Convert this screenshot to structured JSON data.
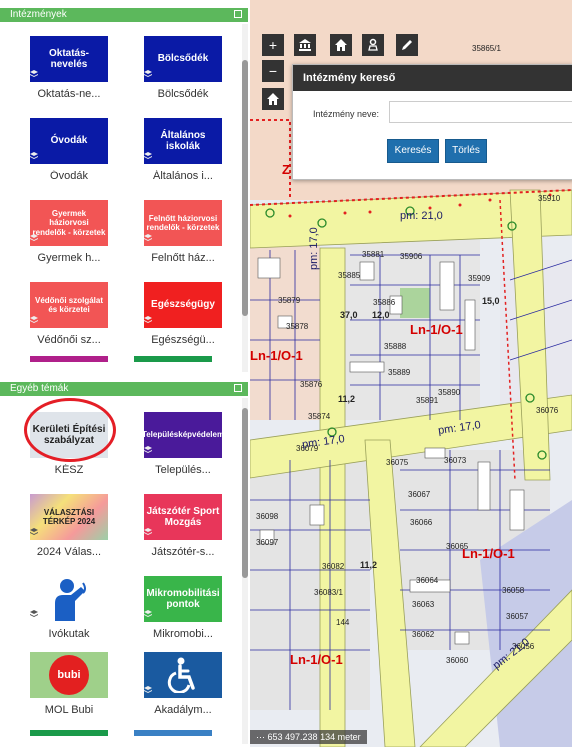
{
  "sidebar": {
    "institutions": {
      "title": "Intézmények",
      "tiles": [
        {
          "thumb": "Oktatás-nevelés",
          "label": "Oktatás-ne...",
          "color": "#0a1aa6"
        },
        {
          "thumb": "Bölcsődék",
          "label": "Bölcsődék",
          "color": "#0a1aa6"
        },
        {
          "thumb": "Óvodák",
          "label": "Óvodák",
          "color": "#0a1aa6"
        },
        {
          "thumb": "Általános iskolák",
          "label": "Általános i...",
          "color": "#0a1aa6"
        },
        {
          "thumb": "Gyermek háziorvosi rendelők - körzetek",
          "label": "Gyermek h...",
          "color": "#f25555"
        },
        {
          "thumb": "Felnőtt háziorvosi rendelők - körzetek",
          "label": "Felnőtt ház...",
          "color": "#f25555"
        },
        {
          "thumb": "Védőnői szolgálat és körzetei",
          "label": "Védőnői sz...",
          "color": "#f25555"
        },
        {
          "thumb": "Egészségügy",
          "label": "Egészségü...",
          "color": "#f02020"
        }
      ]
    },
    "other": {
      "title": "Egyéb témák",
      "tiles": [
        {
          "thumb": "Kerületi Építési szabályzat",
          "label": "KÉSZ",
          "color": "#e8e8e8"
        },
        {
          "thumb": "Településképvédelem",
          "label": "Település...",
          "color": "#4a1a9a"
        },
        {
          "thumb": "VÁLASZTÁSI TÉRKÉP 2024",
          "label": "2024 Válas...",
          "color": "#c89bd0"
        },
        {
          "thumb": "Játszótér Sport Mozgás",
          "label": "Játszótér-s...",
          "color": "#e8365a"
        },
        {
          "thumb": "",
          "label": "Ivókutak",
          "color": "#1b5fc4"
        },
        {
          "thumb": "Mikromobilitási pontok",
          "label": "Mikromobi...",
          "color": "#39b54a"
        },
        {
          "thumb": "bubi",
          "label": "MOL Bubi",
          "color": "#e32020"
        },
        {
          "thumb": "",
          "label": "Akadálym...",
          "color": "#1a5aa0"
        }
      ]
    }
  },
  "toolbar": {
    "zoom_in": "+",
    "zoom_out": "−"
  },
  "search_dialog": {
    "title": "Intézmény kereső",
    "field_label": "Intézmény neve:",
    "field_value": "",
    "search_button": "Keresés",
    "clear_button": "Törlés"
  },
  "map": {
    "zones": [
      "Ln-1/O-1",
      "Ln-1/O-1",
      "Ln-1/O-1",
      "Ln-1/O-1",
      "Z"
    ],
    "pm_labels": [
      "pm: 21,0",
      "pm: 17,0",
      "pm: 17,0",
      "pm: 17,0",
      "pm: 21,0"
    ],
    "parcels": [
      "35865/1",
      "35910",
      "35881",
      "35885",
      "35886",
      "35888",
      "35889",
      "35879",
      "35878",
      "35876",
      "35874",
      "36079",
      "36075",
      "36073",
      "36076",
      "36067",
      "36066",
      "36065",
      "36064",
      "36063",
      "36062",
      "36060",
      "36098",
      "36097",
      "36082",
      "36083/1",
      "36058",
      "36057",
      "36056",
      "35906",
      "35909",
      "35891",
      "35890"
    ],
    "numbers": [
      "37,0",
      "12,0",
      "15,0",
      "11,2",
      "11,2",
      "144"
    ],
    "scale_text": "653 497.238 134 meter"
  }
}
